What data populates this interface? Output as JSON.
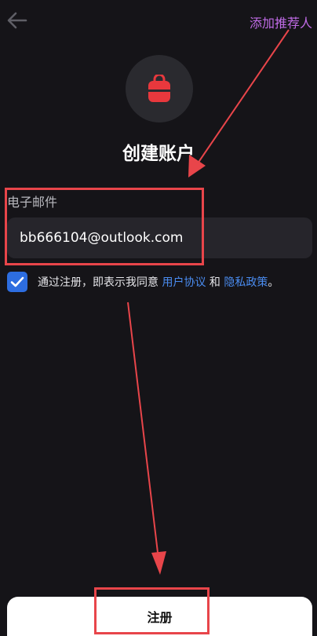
{
  "header": {
    "back_icon": "arrow-left-icon",
    "add_referrer_label": "添加推荐人",
    "add_referrer_color": "#c06be6"
  },
  "avatar": {
    "icon": "backpack-icon",
    "icon_color": "#e8383d"
  },
  "page_title": "创建账户",
  "email": {
    "label": "电子邮件",
    "value": "bb666104@outlook.com"
  },
  "terms": {
    "checked": true,
    "prefix": "通过注册，即表示我同意 ",
    "user_agreement": "用户协议",
    "conjunction": " 和 ",
    "privacy_policy": "隐私政策",
    "suffix": "。",
    "link_color": "#4a8cf0"
  },
  "register_label": "注册",
  "colors": {
    "background": "#151418",
    "accent": "#2d6de0",
    "annotation": "#e8454a"
  }
}
